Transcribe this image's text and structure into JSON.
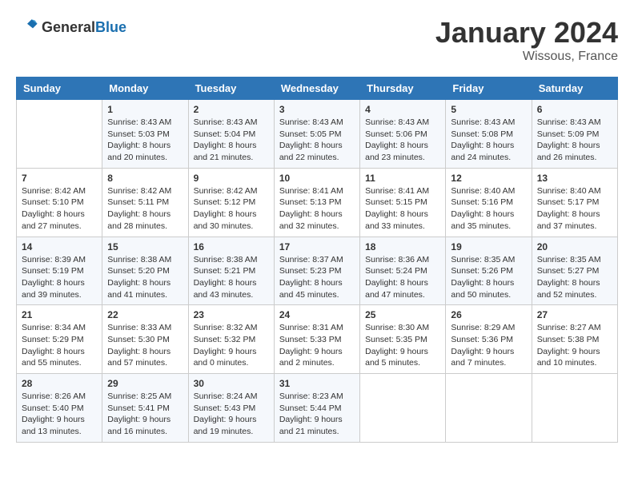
{
  "header": {
    "logo_general": "General",
    "logo_blue": "Blue",
    "month": "January 2024",
    "location": "Wissous, France"
  },
  "weekdays": [
    "Sunday",
    "Monday",
    "Tuesday",
    "Wednesday",
    "Thursday",
    "Friday",
    "Saturday"
  ],
  "weeks": [
    [
      {
        "day": "",
        "sunrise": "",
        "sunset": "",
        "daylight": ""
      },
      {
        "day": "1",
        "sunrise": "Sunrise: 8:43 AM",
        "sunset": "Sunset: 5:03 PM",
        "daylight": "Daylight: 8 hours and 20 minutes."
      },
      {
        "day": "2",
        "sunrise": "Sunrise: 8:43 AM",
        "sunset": "Sunset: 5:04 PM",
        "daylight": "Daylight: 8 hours and 21 minutes."
      },
      {
        "day": "3",
        "sunrise": "Sunrise: 8:43 AM",
        "sunset": "Sunset: 5:05 PM",
        "daylight": "Daylight: 8 hours and 22 minutes."
      },
      {
        "day": "4",
        "sunrise": "Sunrise: 8:43 AM",
        "sunset": "Sunset: 5:06 PM",
        "daylight": "Daylight: 8 hours and 23 minutes."
      },
      {
        "day": "5",
        "sunrise": "Sunrise: 8:43 AM",
        "sunset": "Sunset: 5:08 PM",
        "daylight": "Daylight: 8 hours and 24 minutes."
      },
      {
        "day": "6",
        "sunrise": "Sunrise: 8:43 AM",
        "sunset": "Sunset: 5:09 PM",
        "daylight": "Daylight: 8 hours and 26 minutes."
      }
    ],
    [
      {
        "day": "7",
        "sunrise": "Sunrise: 8:42 AM",
        "sunset": "Sunset: 5:10 PM",
        "daylight": "Daylight: 8 hours and 27 minutes."
      },
      {
        "day": "8",
        "sunrise": "Sunrise: 8:42 AM",
        "sunset": "Sunset: 5:11 PM",
        "daylight": "Daylight: 8 hours and 28 minutes."
      },
      {
        "day": "9",
        "sunrise": "Sunrise: 8:42 AM",
        "sunset": "Sunset: 5:12 PM",
        "daylight": "Daylight: 8 hours and 30 minutes."
      },
      {
        "day": "10",
        "sunrise": "Sunrise: 8:41 AM",
        "sunset": "Sunset: 5:13 PM",
        "daylight": "Daylight: 8 hours and 32 minutes."
      },
      {
        "day": "11",
        "sunrise": "Sunrise: 8:41 AM",
        "sunset": "Sunset: 5:15 PM",
        "daylight": "Daylight: 8 hours and 33 minutes."
      },
      {
        "day": "12",
        "sunrise": "Sunrise: 8:40 AM",
        "sunset": "Sunset: 5:16 PM",
        "daylight": "Daylight: 8 hours and 35 minutes."
      },
      {
        "day": "13",
        "sunrise": "Sunrise: 8:40 AM",
        "sunset": "Sunset: 5:17 PM",
        "daylight": "Daylight: 8 hours and 37 minutes."
      }
    ],
    [
      {
        "day": "14",
        "sunrise": "Sunrise: 8:39 AM",
        "sunset": "Sunset: 5:19 PM",
        "daylight": "Daylight: 8 hours and 39 minutes."
      },
      {
        "day": "15",
        "sunrise": "Sunrise: 8:38 AM",
        "sunset": "Sunset: 5:20 PM",
        "daylight": "Daylight: 8 hours and 41 minutes."
      },
      {
        "day": "16",
        "sunrise": "Sunrise: 8:38 AM",
        "sunset": "Sunset: 5:21 PM",
        "daylight": "Daylight: 8 hours and 43 minutes."
      },
      {
        "day": "17",
        "sunrise": "Sunrise: 8:37 AM",
        "sunset": "Sunset: 5:23 PM",
        "daylight": "Daylight: 8 hours and 45 minutes."
      },
      {
        "day": "18",
        "sunrise": "Sunrise: 8:36 AM",
        "sunset": "Sunset: 5:24 PM",
        "daylight": "Daylight: 8 hours and 47 minutes."
      },
      {
        "day": "19",
        "sunrise": "Sunrise: 8:35 AM",
        "sunset": "Sunset: 5:26 PM",
        "daylight": "Daylight: 8 hours and 50 minutes."
      },
      {
        "day": "20",
        "sunrise": "Sunrise: 8:35 AM",
        "sunset": "Sunset: 5:27 PM",
        "daylight": "Daylight: 8 hours and 52 minutes."
      }
    ],
    [
      {
        "day": "21",
        "sunrise": "Sunrise: 8:34 AM",
        "sunset": "Sunset: 5:29 PM",
        "daylight": "Daylight: 8 hours and 55 minutes."
      },
      {
        "day": "22",
        "sunrise": "Sunrise: 8:33 AM",
        "sunset": "Sunset: 5:30 PM",
        "daylight": "Daylight: 8 hours and 57 minutes."
      },
      {
        "day": "23",
        "sunrise": "Sunrise: 8:32 AM",
        "sunset": "Sunset: 5:32 PM",
        "daylight": "Daylight: 9 hours and 0 minutes."
      },
      {
        "day": "24",
        "sunrise": "Sunrise: 8:31 AM",
        "sunset": "Sunset: 5:33 PM",
        "daylight": "Daylight: 9 hours and 2 minutes."
      },
      {
        "day": "25",
        "sunrise": "Sunrise: 8:30 AM",
        "sunset": "Sunset: 5:35 PM",
        "daylight": "Daylight: 9 hours and 5 minutes."
      },
      {
        "day": "26",
        "sunrise": "Sunrise: 8:29 AM",
        "sunset": "Sunset: 5:36 PM",
        "daylight": "Daylight: 9 hours and 7 minutes."
      },
      {
        "day": "27",
        "sunrise": "Sunrise: 8:27 AM",
        "sunset": "Sunset: 5:38 PM",
        "daylight": "Daylight: 9 hours and 10 minutes."
      }
    ],
    [
      {
        "day": "28",
        "sunrise": "Sunrise: 8:26 AM",
        "sunset": "Sunset: 5:40 PM",
        "daylight": "Daylight: 9 hours and 13 minutes."
      },
      {
        "day": "29",
        "sunrise": "Sunrise: 8:25 AM",
        "sunset": "Sunset: 5:41 PM",
        "daylight": "Daylight: 9 hours and 16 minutes."
      },
      {
        "day": "30",
        "sunrise": "Sunrise: 8:24 AM",
        "sunset": "Sunset: 5:43 PM",
        "daylight": "Daylight: 9 hours and 19 minutes."
      },
      {
        "day": "31",
        "sunrise": "Sunrise: 8:23 AM",
        "sunset": "Sunset: 5:44 PM",
        "daylight": "Daylight: 9 hours and 21 minutes."
      },
      {
        "day": "",
        "sunrise": "",
        "sunset": "",
        "daylight": ""
      },
      {
        "day": "",
        "sunrise": "",
        "sunset": "",
        "daylight": ""
      },
      {
        "day": "",
        "sunrise": "",
        "sunset": "",
        "daylight": ""
      }
    ]
  ]
}
